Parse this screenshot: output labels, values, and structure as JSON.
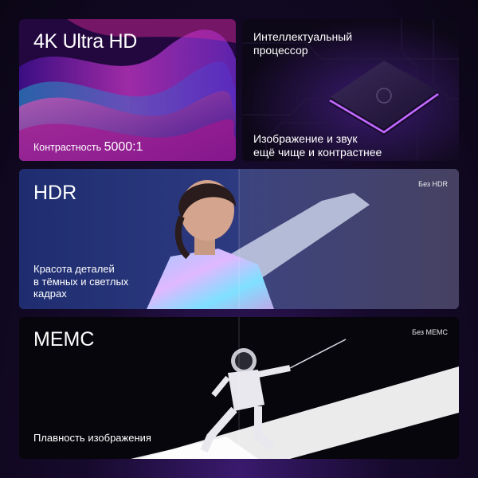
{
  "panels": {
    "uhd": {
      "title": "4K Ultra HD",
      "caption_prefix": "Контрастность",
      "caption_value": "5000:1"
    },
    "processor": {
      "line1": "Интеллектуальный",
      "line2": "процессор",
      "line3": "Изображение и звук",
      "line4": "ещё чище и контрастнее"
    },
    "hdr": {
      "title": "HDR",
      "caption_line1": "Красота деталей",
      "caption_line2": "в тёмных и светлых",
      "caption_line3": "кадрах",
      "without_label": "Без HDR"
    },
    "memc": {
      "title": "MEMC",
      "caption": "Плавность изображения",
      "without_label": "Без MEMC"
    }
  },
  "colors": {
    "accent_purple": "#9b3bff",
    "accent_magenta": "#e43ad6",
    "background": "#160a2c"
  }
}
